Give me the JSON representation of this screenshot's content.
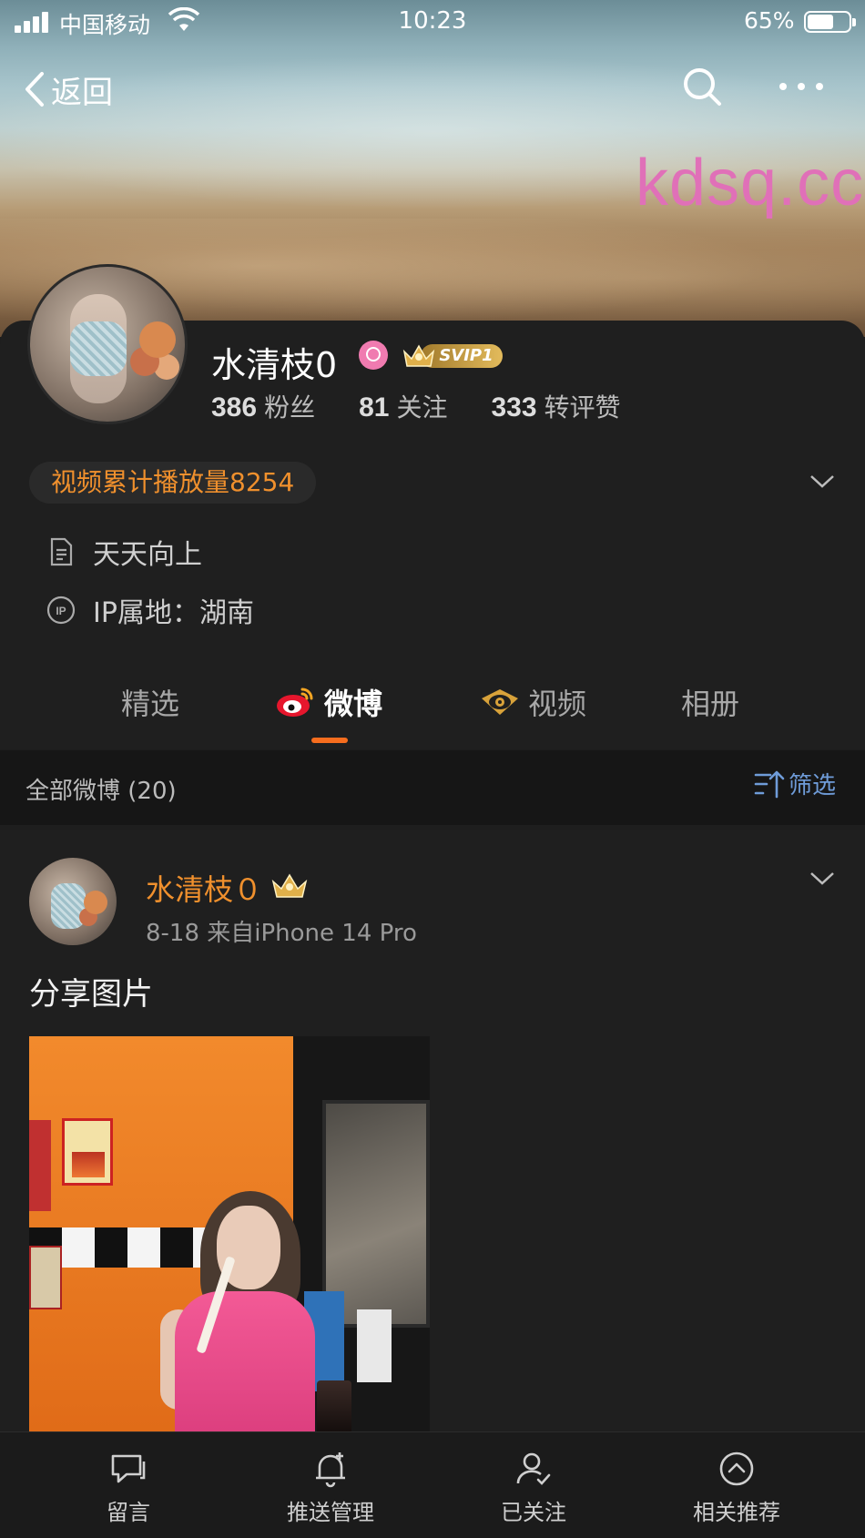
{
  "status_bar": {
    "carrier": "中国移动",
    "time": "10:23",
    "battery": "65%",
    "battery_level": 0.65
  },
  "nav": {
    "back_label": "返回",
    "search_icon": "search-icon",
    "more_icon": "more-horizontal-icon"
  },
  "watermark": "kdsq.cc",
  "profile": {
    "name": "水清枝0",
    "gender_icon": "female-icon",
    "vip_badge": "SVIP1",
    "stats": [
      {
        "count": "386",
        "label": "粉丝"
      },
      {
        "count": "81",
        "label": "关注"
      },
      {
        "count": "333",
        "label": "转评赞"
      }
    ],
    "video_plays": "视频累计播放量8254",
    "bio": "天天向上",
    "ip_location": "IP属地：湖南"
  },
  "tabs": [
    {
      "label": "精选",
      "active": false
    },
    {
      "label": "微博",
      "active": true
    },
    {
      "label": "视频",
      "active": false
    },
    {
      "label": "相册",
      "active": false
    }
  ],
  "feed_header": {
    "all_posts": "全部微博 (20)",
    "filter_label": "筛选"
  },
  "post": {
    "author": "水清枝０",
    "meta": "8-18  来自iPhone 14 Pro",
    "text": "分享图片"
  },
  "bottom_bar": [
    {
      "label": "留言",
      "icon": "message-icon"
    },
    {
      "label": "推送管理",
      "icon": "bell-plus-icon"
    },
    {
      "label": "已关注",
      "icon": "user-check-icon"
    },
    {
      "label": "相关推荐",
      "icon": "chevron-up-circle-icon"
    }
  ],
  "colors": {
    "accent_orange": "#f0902d",
    "tab_underline": "#f66d1e",
    "link_blue": "#6f9cd9",
    "background": "#1f1f1f"
  }
}
